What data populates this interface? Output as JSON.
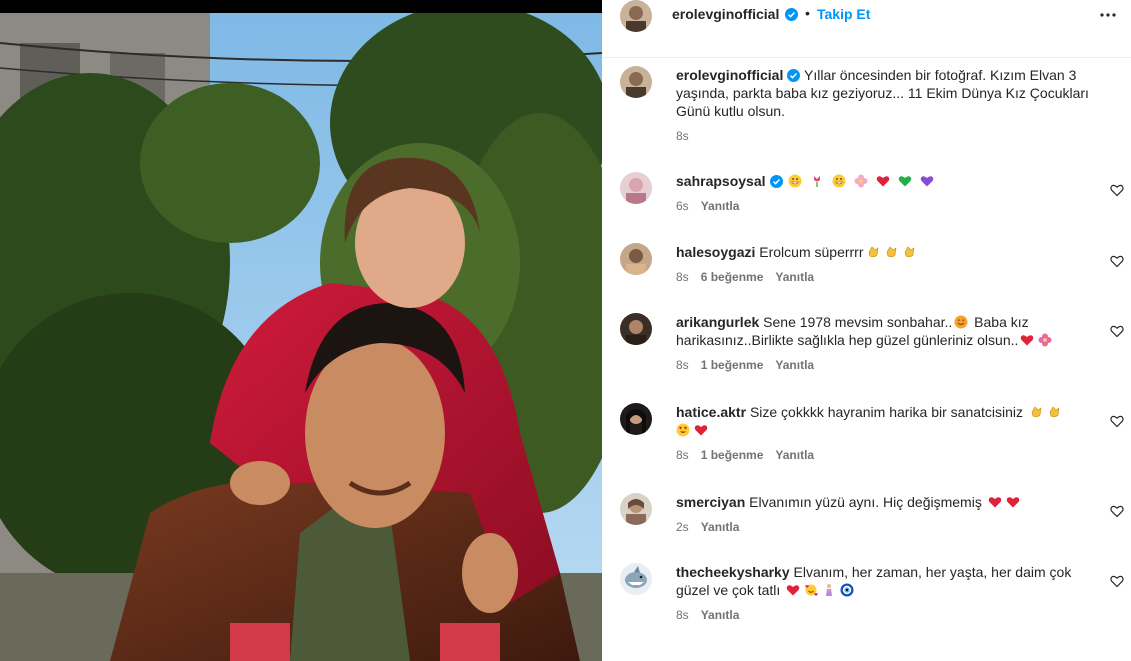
{
  "post": {
    "author": "erolevginofficial",
    "follow_label": "Takip Et",
    "separator": "•",
    "caption": "Yıllar öncesinden bir fotoğraf. Kızım Elvan 3 yaşında, parkta baba kız geziyoruz... 11 Ekim Dünya Kız Çocukları Günü kutlu olsun.",
    "time": "8s"
  },
  "comments": [
    {
      "user": "sahrapsoysal",
      "verified": true,
      "text": "",
      "emojis": [
        "grin",
        "tulip",
        "grin",
        "blossom",
        "red-heart",
        "green-heart",
        "purple-heart"
      ],
      "time": "6s",
      "likes": "",
      "reply": "Yanıtla"
    },
    {
      "user": "halesoygazi",
      "verified": false,
      "text": "Erolcum süperrrr",
      "emojis": [
        "clap",
        "clap",
        "clap"
      ],
      "time": "8s",
      "likes": "6 beğenme",
      "reply": "Yanıtla"
    },
    {
      "user": "arikangurlek",
      "verified": false,
      "text": "Sene 1978 mevsim sonbahar..",
      "text2": " Baba kız harikasınız..Birlikte sağlıkla hep güzel günleriniz olsun..",
      "time": "8s",
      "likes": "1 beğenme",
      "reply": "Yanıtla"
    },
    {
      "user": "hatice.aktr",
      "verified": false,
      "text": "Size çokkkk hayranim harika bir sanatcisiniz",
      "time": "8s",
      "likes": "1 beğenme",
      "reply": "Yanıtla"
    },
    {
      "user": "smerciyan",
      "verified": false,
      "text": "Elvanımın yüzü aynı. Hiç değişmemiş",
      "time": "2s",
      "likes": "",
      "reply": "Yanıtla"
    },
    {
      "user": "thecheekysharky",
      "verified": false,
      "text": "Elvanım, her zaman, her yaşta, her daim çok güzel ve çok tatlı",
      "time": "8s",
      "likes": "",
      "reply": "Yanıtla"
    }
  ],
  "colors": {
    "link": "#0095f6",
    "verified": "#0095f6",
    "meta": "#737373",
    "text": "#262626"
  },
  "icons": {
    "more": "more-horizontal-icon",
    "like": "heart-outline-icon",
    "verified": "verified-badge-icon"
  }
}
